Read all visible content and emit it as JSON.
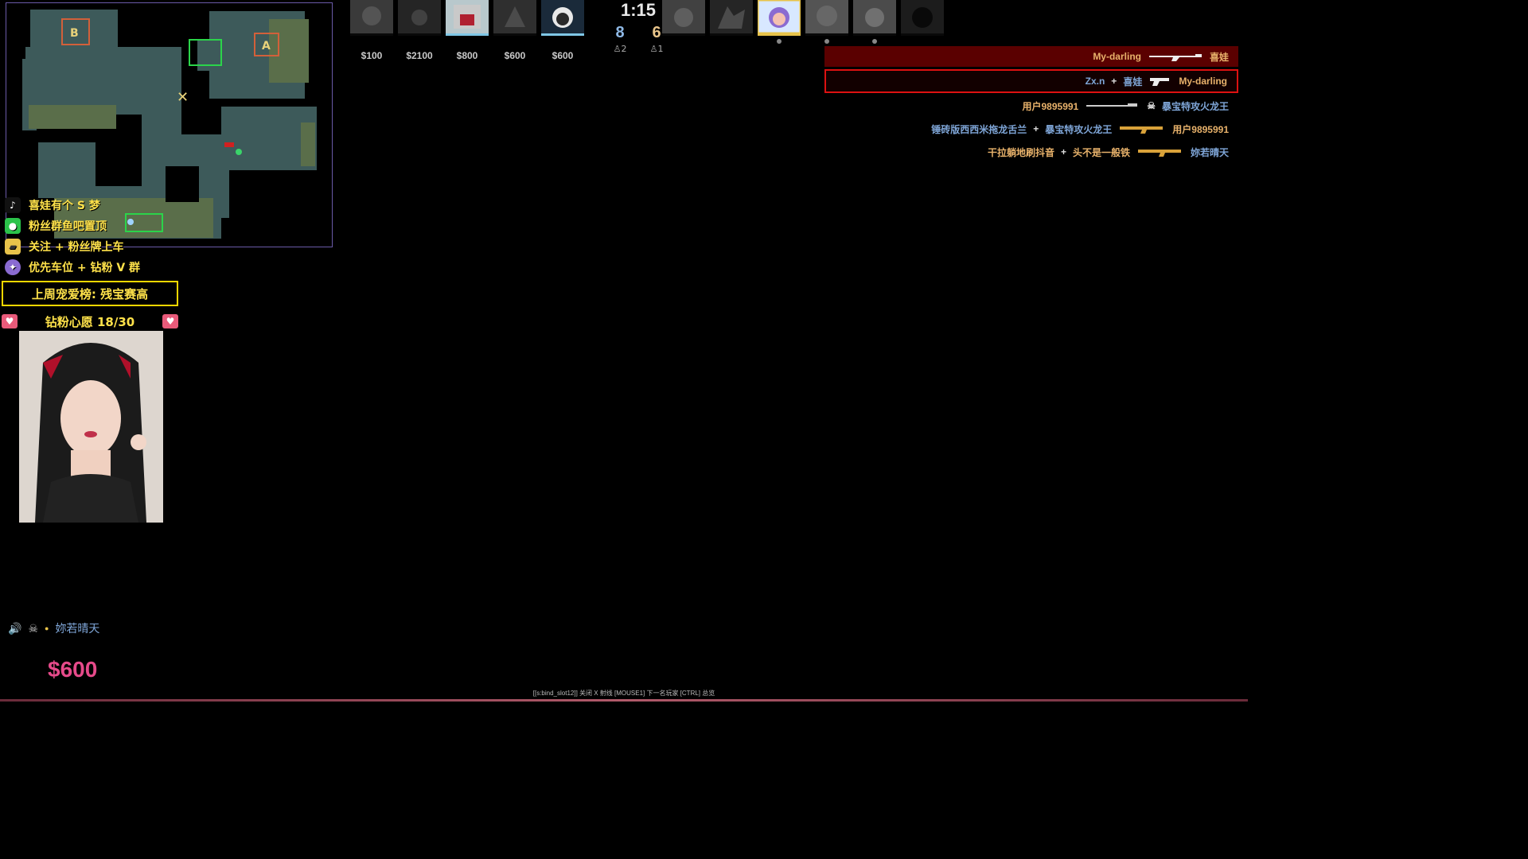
{
  "match": {
    "timer": "1:15",
    "score_ct": "8",
    "score_t": "6",
    "alive_ct": "2",
    "alive_t": "1"
  },
  "ct_players": [
    {
      "money": "$100",
      "state": "dead"
    },
    {
      "money": "$2100",
      "state": "dead"
    },
    {
      "money": "$800",
      "state": "alive"
    },
    {
      "money": "$600",
      "state": "dead"
    },
    {
      "money": "$600",
      "state": "alive"
    }
  ],
  "t_players": [
    {
      "state": "dead"
    },
    {
      "state": "dead"
    },
    {
      "state": "alive"
    },
    {
      "state": "dead"
    },
    {
      "state": "dead"
    },
    {
      "state": "dead"
    }
  ],
  "radar": {
    "site_a": "A",
    "site_b": "B"
  },
  "killfeed": [
    {
      "killer": "My-darling",
      "victim": "喜娃",
      "style": "mine"
    },
    {
      "killer": "Zx.n",
      "assist": "喜娃",
      "victim": "My-darling",
      "style": "victim"
    },
    {
      "killer": "用户9895991",
      "victim": "暴宝特攻火龙王",
      "style": "normal"
    },
    {
      "killer": "锤砖版西西米拖龙舌兰",
      "assist": "暴宝特攻火龙王",
      "victim": "用户9895991",
      "style": "normal"
    },
    {
      "killer": "干拉躺地刷抖音",
      "assist": "头不是一般铁",
      "victim": "妳若晴天",
      "style": "normal"
    }
  ],
  "overlay": {
    "line1": "喜娃有个 S 梦",
    "line2": "粉丝群鱼吧置顶",
    "line3": "关注 + 粉丝牌上车",
    "line4": "优先车位 + 钻粉 V 群",
    "leaderboard": "上周宠爱榜: 残宝赛高",
    "wish": "钻粉心愿   18/30",
    "icons": [
      "tiktok-icon",
      "wechat-icon",
      "ticket-icon",
      "badge-icon"
    ]
  },
  "spectate": {
    "player": "妳若晴天",
    "money": "$600"
  },
  "hint": "[[s:bind_slot12]] 关闭 X 射线     [MOUSE1] 下一名玩家     [CTRL] 总览",
  "colors": {
    "ct": "#7fa6d8",
    "t": "#e8b26b",
    "overlay_text": "#ffe24a",
    "money_big": "#e64a8a"
  }
}
